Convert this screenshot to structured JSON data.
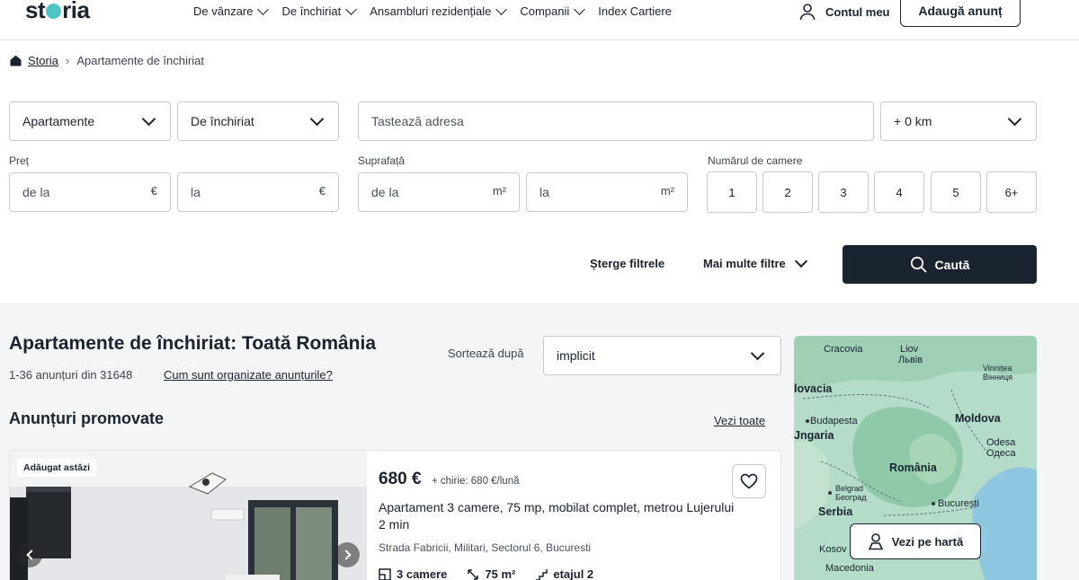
{
  "header": {
    "logo": "storia",
    "nav": [
      {
        "label": "De vânzare",
        "has_dropdown": true
      },
      {
        "label": "De închiriat",
        "has_dropdown": true
      },
      {
        "label": "Ansambluri rezidențiale",
        "has_dropdown": true
      },
      {
        "label": "Companii",
        "has_dropdown": true
      },
      {
        "label": "Index Cartiere",
        "has_dropdown": false
      }
    ],
    "account_label": "Contul meu",
    "add_listing_label": "Adaugă anunț"
  },
  "breadcrumb": {
    "home": "Storia",
    "separator": "›",
    "current": "Apartamente de închiriat"
  },
  "filters": {
    "property_type": "Apartamente",
    "transaction": "De închiriat",
    "address_placeholder": "Tastează adresa",
    "radius": "+ 0 km",
    "price_label": "Preț",
    "price_from": "de la",
    "price_to": "la",
    "price_unit": "€",
    "area_label": "Suprafață",
    "area_from": "de la",
    "area_to": "la",
    "area_unit": "m²",
    "rooms_label": "Numărul de camere",
    "rooms": [
      "1",
      "2",
      "3",
      "4",
      "5",
      "6+"
    ],
    "clear_label": "Șterge filtrele",
    "more_label": "Mai multe filtre",
    "search_label": "Caută"
  },
  "results": {
    "title": "Apartamente de închiriat: Toată România",
    "count": "1-36 anunțuri din 31648",
    "organize_link": "Cum sunt organizate anunțurile?",
    "sort_label": "Sortează după",
    "sort_value": "implicit",
    "promoted_title": "Anunțuri promovate",
    "see_all": "Vezi toate"
  },
  "listing": {
    "badge": "Adăugat astăzi",
    "price": "680 €",
    "rent": "+ chirie: 680 €/lună",
    "title": "Apartament 3 camere, 75 mp, mobilat complet, metrou Lujerului 2 min",
    "address": "Strada Fabricii, Militari, Sectorul 6, Bucuresti",
    "rooms": "3 camere",
    "area": "75 m²",
    "floor": "etajul 2"
  },
  "map": {
    "button_label": "Vezi pe hartă",
    "labels": {
      "cracovia": "Cracovia",
      "liov": "Liov",
      "lviv": "Львів",
      "vinnitea": "Vinnițea",
      "vinnytsia": "Вінниця",
      "slovacia": "lovacia",
      "budapesta": "Budapesta",
      "ungaria": "Jngaria",
      "moldova": "Moldova",
      "odesa": "Odesa",
      "odesa_cyr": "Одеса",
      "romania": "România",
      "belgrad": "Belgrad",
      "beograd": "Београд",
      "serbia": "Serbia",
      "bucuresti": "București",
      "kosovo": "Kosov",
      "macedonia": "Macedonia"
    }
  },
  "colors": {
    "brand_dark": "#1a2330",
    "brand_teal": "#4fc5c2",
    "section_bg": "#f4f5f6",
    "map_base": "#a8d5c5"
  }
}
